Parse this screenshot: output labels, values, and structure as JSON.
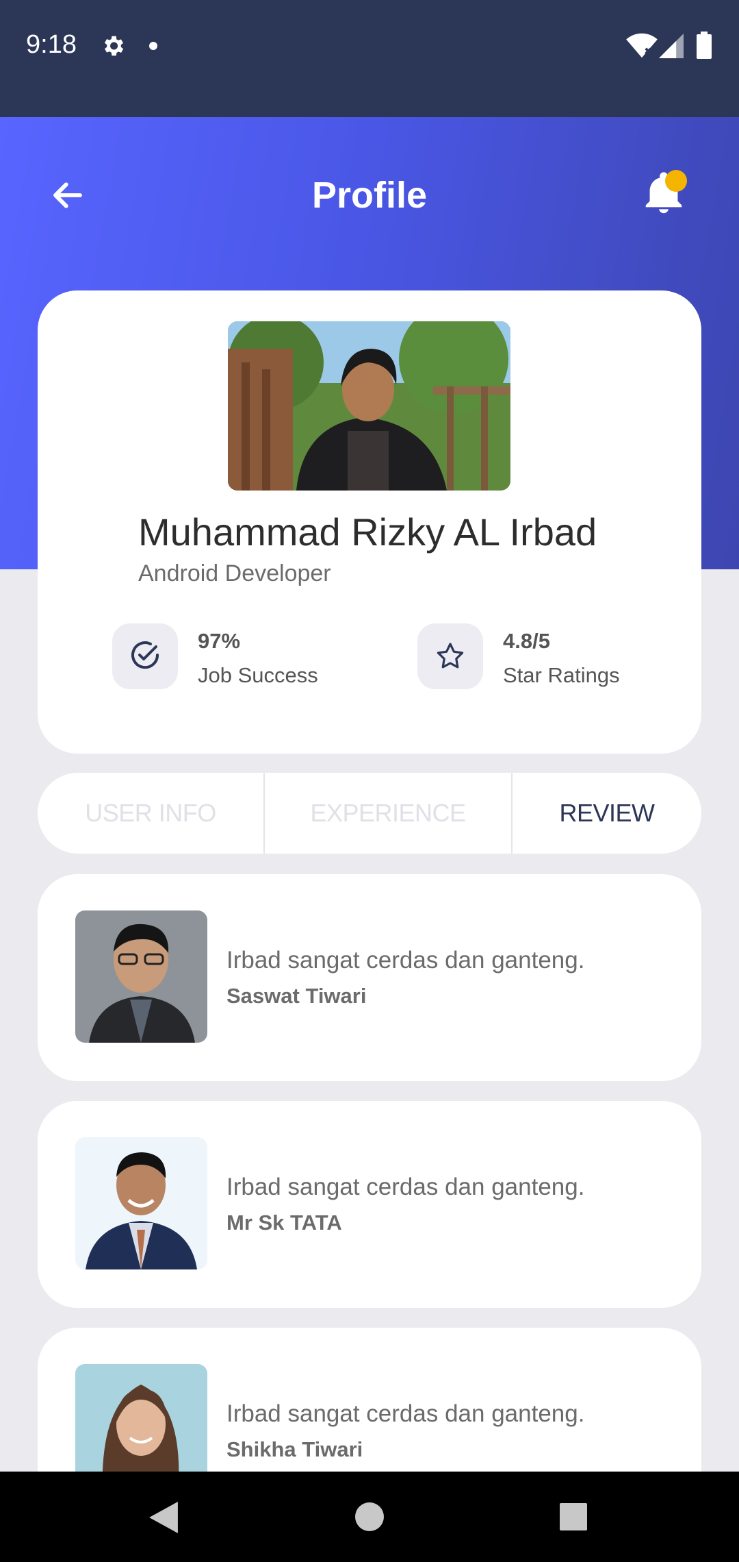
{
  "status_bar": {
    "time": "9:18",
    "icons": [
      "gear-icon",
      "dot-icon",
      "wifi-icon",
      "signal-icon",
      "battery-icon"
    ]
  },
  "header": {
    "title": "Profile",
    "back_icon": "arrow-left-icon",
    "notification_icon": "bell-icon",
    "badge_color": "#f5b400"
  },
  "profile": {
    "name": "Muhammad Rizky AL Irbad",
    "role": "Android Developer",
    "stats": [
      {
        "icon": "check-circle-icon",
        "value": "97%",
        "label": "Job Success"
      },
      {
        "icon": "star-icon",
        "value": "4.8/5",
        "label": "Star Ratings"
      }
    ]
  },
  "tabs": [
    {
      "label": "USER INFO",
      "active": false
    },
    {
      "label": "EXPERIENCE",
      "active": false
    },
    {
      "label": "REVIEW",
      "active": true
    }
  ],
  "reviews": [
    {
      "text": "Irbad sangat cerdas dan ganteng.",
      "author": "Saswat Tiwari"
    },
    {
      "text": "Irbad sangat cerdas dan ganteng.",
      "author": "Mr Sk TATA"
    },
    {
      "text": "Irbad sangat cerdas dan ganteng.",
      "author": "Shikha Tiwari"
    }
  ],
  "nav_bar": {
    "buttons": [
      "back-triangle-icon",
      "home-circle-icon",
      "recents-square-icon"
    ]
  },
  "colors": {
    "status_bar": "#2c3657",
    "header_start": "#5865ff",
    "header_end": "#3d46b0",
    "active_tab": "#2c3657",
    "inactive_tab": "#e0e0e6"
  }
}
